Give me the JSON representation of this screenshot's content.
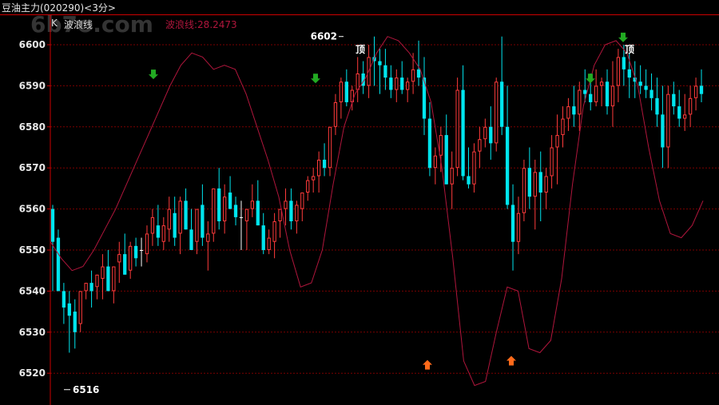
{
  "window": {
    "instrument": "豆油主力(020290)<3分>"
  },
  "indicator": {
    "k_label": "K",
    "name": "波浪线",
    "value_label": "波浪线:28.2473"
  },
  "watermark": "6b7o.com",
  "colors": {
    "up": "#ff3b3b",
    "down": "#00e5ee",
    "neutral": "#ffffff",
    "grid": "#7a0000",
    "wave": "#b0163c",
    "axis": "#cc0000",
    "sell_arrow": "#22aa22",
    "buy_arrow": "#ff6a1a"
  },
  "chart_data": {
    "type": "candlestick",
    "ylim": [
      6514,
      6604
    ],
    "yticks": [
      6520,
      6530,
      6540,
      6550,
      6560,
      6570,
      6580,
      6590,
      6600
    ],
    "annotations": {
      "high": {
        "value": 6602,
        "label": "6602"
      },
      "low": {
        "value": 6516,
        "label": "6516"
      },
      "top_label": "顶"
    },
    "candles": [
      [
        6560,
        6561,
        6540,
        6552
      ],
      [
        6553,
        6555,
        6540,
        6540
      ],
      [
        6540,
        6542,
        6532,
        6536
      ],
      [
        6537,
        6540,
        6525,
        6534
      ],
      [
        6535,
        6538,
        6526,
        6530
      ],
      [
        6532,
        6540,
        6530,
        6540
      ],
      [
        6540,
        6542,
        6538,
        6542
      ],
      [
        6542,
        6545,
        6536,
        6540
      ],
      [
        6541,
        6544,
        6538,
        6544
      ],
      [
        6543,
        6549,
        6538,
        6546
      ],
      [
        6546,
        6550,
        6540,
        6540
      ],
      [
        6540,
        6546,
        6537,
        6546
      ],
      [
        6547,
        6552,
        6542,
        6549
      ],
      [
        6549,
        6554,
        6544,
        6544
      ],
      [
        6545,
        6552,
        6543,
        6551
      ],
      [
        6551,
        6553,
        6546,
        6548
      ],
      [
        6550,
        6553,
        6546,
        6550
      ],
      [
        6549,
        6556,
        6547,
        6554
      ],
      [
        6554,
        6560,
        6551,
        6558
      ],
      [
        6556,
        6561,
        6551,
        6553
      ],
      [
        6552,
        6558,
        6550,
        6556
      ],
      [
        6555,
        6563,
        6552,
        6560
      ],
      [
        6559,
        6563,
        6551,
        6553
      ],
      [
        6554,
        6563,
        6549,
        6562
      ],
      [
        6562,
        6565,
        6555,
        6555
      ],
      [
        6555,
        6560,
        6550,
        6550
      ],
      [
        6552,
        6558,
        6549,
        6560
      ],
      [
        6561,
        6566,
        6551,
        6553
      ],
      [
        6552,
        6557,
        6545,
        6554
      ],
      [
        6554,
        6565,
        6552,
        6565
      ],
      [
        6565,
        6570,
        6555,
        6557
      ],
      [
        6557,
        6566,
        6554,
        6563
      ],
      [
        6564,
        6568,
        6560,
        6560
      ],
      [
        6561,
        6563,
        6556,
        6558
      ],
      [
        6558,
        6562,
        6550,
        6558
      ],
      [
        6557,
        6560,
        6550,
        6560
      ],
      [
        6560,
        6566,
        6558,
        6562
      ],
      [
        6562,
        6567,
        6556,
        6556
      ],
      [
        6556,
        6559,
        6549,
        6550
      ],
      [
        6550,
        6555,
        6549,
        6553
      ],
      [
        6552,
        6559,
        6548,
        6557
      ],
      [
        6557,
        6560,
        6553,
        6560
      ],
      [
        6560,
        6565,
        6556,
        6562
      ],
      [
        6562,
        6565,
        6555,
        6557
      ],
      [
        6557,
        6562,
        6554,
        6561
      ],
      [
        6560,
        6564,
        6557,
        6564
      ],
      [
        6564,
        6568,
        6562,
        6567
      ],
      [
        6567,
        6570,
        6564,
        6568
      ],
      [
        6568,
        6574,
        6564,
        6572
      ],
      [
        6572,
        6576,
        6568,
        6570
      ],
      [
        6570,
        6580,
        6568,
        6580
      ],
      [
        6580,
        6588,
        6578,
        6586
      ],
      [
        6586,
        6592,
        6582,
        6591
      ],
      [
        6591,
        6594,
        6585,
        6586
      ],
      [
        6586,
        6590,
        6584,
        6589
      ],
      [
        6589,
        6597,
        6586,
        6593
      ],
      [
        6593,
        6596,
        6588,
        6590
      ],
      [
        6590,
        6600,
        6587,
        6597
      ],
      [
        6597,
        6602,
        6590,
        6596
      ],
      [
        6596,
        6599,
        6588,
        6595
      ],
      [
        6595,
        6599,
        6589,
        6592
      ],
      [
        6592,
        6595,
        6587,
        6589
      ],
      [
        6589,
        6594,
        6586,
        6592
      ],
      [
        6592,
        6596,
        6588,
        6589
      ],
      [
        6589,
        6592,
        6586,
        6591
      ],
      [
        6591,
        6598,
        6588,
        6594
      ],
      [
        6594,
        6601,
        6590,
        6592
      ],
      [
        6592,
        6597,
        6578,
        6582
      ],
      [
        6582,
        6586,
        6568,
        6570
      ],
      [
        6570,
        6575,
        6566,
        6573
      ],
      [
        6573,
        6580,
        6569,
        6578
      ],
      [
        6578,
        6583,
        6566,
        6566
      ],
      [
        6566,
        6574,
        6560,
        6570
      ],
      [
        6570,
        6592,
        6568,
        6589
      ],
      [
        6589,
        6595,
        6567,
        6568
      ],
      [
        6568,
        6575,
        6565,
        6566
      ],
      [
        6566,
        6576,
        6564,
        6574
      ],
      [
        6574,
        6580,
        6570,
        6577
      ],
      [
        6577,
        6582,
        6575,
        6580
      ],
      [
        6580,
        6585,
        6572,
        6576
      ],
      [
        6576,
        6592,
        6574,
        6591
      ],
      [
        6591,
        6602,
        6578,
        6580
      ],
      [
        6580,
        6590,
        6560,
        6561
      ],
      [
        6561,
        6566,
        6545,
        6552
      ],
      [
        6552,
        6563,
        6549,
        6559
      ],
      [
        6559,
        6572,
        6557,
        6570
      ],
      [
        6570,
        6575,
        6560,
        6563
      ],
      [
        6563,
        6572,
        6555,
        6569
      ],
      [
        6569,
        6574,
        6557,
        6564
      ],
      [
        6564,
        6570,
        6560,
        6568
      ],
      [
        6568,
        6578,
        6565,
        6575
      ],
      [
        6575,
        6583,
        6566,
        6578
      ],
      [
        6578,
        6585,
        6575,
        6582
      ],
      [
        6582,
        6587,
        6579,
        6585
      ],
      [
        6585,
        6590,
        6580,
        6583
      ],
      [
        6583,
        6591,
        6579,
        6589
      ],
      [
        6589,
        6594,
        6586,
        6588
      ],
      [
        6588,
        6593,
        6584,
        6586
      ],
      [
        6586,
        6594,
        6585,
        6590
      ],
      [
        6590,
        6592,
        6585,
        6591
      ],
      [
        6591,
        6594,
        6583,
        6585
      ],
      [
        6585,
        6596,
        6580,
        6590
      ],
      [
        6590,
        6599,
        6586,
        6597
      ],
      [
        6597,
        6600,
        6590,
        6594
      ],
      [
        6594,
        6598,
        6587,
        6592
      ],
      [
        6592,
        6596,
        6587,
        6591
      ],
      [
        6591,
        6595,
        6588,
        6590
      ],
      [
        6590,
        6594,
        6587,
        6589
      ],
      [
        6589,
        6593,
        6584,
        6587
      ],
      [
        6587,
        6592,
        6580,
        6583
      ],
      [
        6583,
        6590,
        6570,
        6575
      ],
      [
        6575,
        6590,
        6570,
        6588
      ],
      [
        6588,
        6591,
        6583,
        6585
      ],
      [
        6585,
        6589,
        6580,
        6582
      ],
      [
        6582,
        6588,
        6579,
        6583
      ],
      [
        6583,
        6590,
        6580,
        6587
      ],
      [
        6587,
        6592,
        6584,
        6590
      ],
      [
        6590,
        6594,
        6586,
        6588
      ]
    ],
    "wave": [
      6552,
      6548,
      6545,
      6546,
      6550,
      6555,
      6560,
      6566,
      6572,
      6578,
      6584,
      6590,
      6595,
      6598,
      6597,
      6594,
      6595,
      6594,
      6588,
      6580,
      6572,
      6563,
      6550,
      6541,
      6542,
      6550,
      6566,
      6580,
      6588,
      6592,
      6598,
      6602,
      6601,
      6598,
      6594,
      6586,
      6570,
      6548,
      6523,
      6517,
      6518,
      6530,
      6541,
      6540,
      6526,
      6525,
      6528,
      6543,
      6566,
      6585,
      6595,
      6600,
      6601,
      6598,
      6590,
      6575,
      6562,
      6554,
      6553,
      6556,
      6562
    ],
    "sell_signals": [
      6592,
      6591,
      6591,
      6601
    ],
    "buy_signals": [
      6524,
      6525
    ],
    "top_labels": 2
  }
}
